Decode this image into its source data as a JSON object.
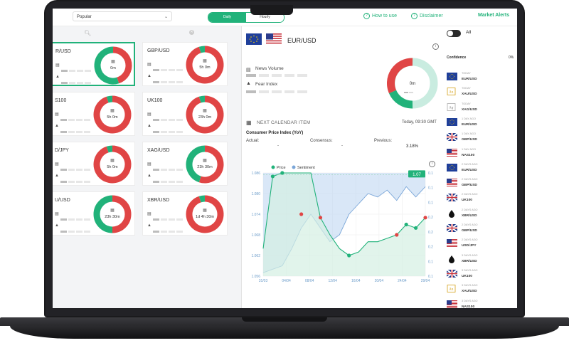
{
  "topbar": {
    "dropdown_value": "Popular",
    "tabs": [
      {
        "label": "Daily",
        "active": true
      },
      {
        "label": "Hourly",
        "active": false
      }
    ],
    "how_to_use": "How to use",
    "disclaimer": "Disclaimer",
    "market_alerts": "Market Alerts"
  },
  "cards": [
    {
      "symbol": "R/USD",
      "donut_label": "0m",
      "selected": true,
      "green_fraction": 0.55,
      "row": 0,
      "col": 0
    },
    {
      "symbol": "GBP/USD",
      "donut_label": "5h 0m",
      "selected": false,
      "green_fraction": 0.05,
      "row": 0,
      "col": 1
    },
    {
      "symbol": "S100",
      "donut_label": "5h 0m",
      "selected": false,
      "green_fraction": 0.05,
      "row": 1,
      "col": 0
    },
    {
      "symbol": "UK100",
      "donut_label": "23h 0m",
      "selected": false,
      "green_fraction": 0.05,
      "row": 1,
      "col": 1
    },
    {
      "symbol": "D/JPY",
      "donut_label": "5h 0m",
      "selected": false,
      "green_fraction": 0.05,
      "row": 2,
      "col": 0
    },
    {
      "symbol": "XAG/USD",
      "donut_label": "23h 30m",
      "selected": false,
      "green_fraction": 0.45,
      "row": 2,
      "col": 1
    },
    {
      "symbol": "U/USD",
      "donut_label": "23h 30m",
      "selected": false,
      "green_fraction": 0.5,
      "row": 3,
      "col": 0
    },
    {
      "symbol": "XBR/USD",
      "donut_label": "1d 4h 30m",
      "selected": false,
      "green_fraction": 0.05,
      "row": 3,
      "col": 1
    }
  ],
  "detail": {
    "pair": "EUR/USD",
    "news_volume_label": "News Volume",
    "fear_index_label": "Fear Index",
    "donut_label": "0m",
    "calendar_title": "NEXT CALENDAR ITEM",
    "calendar_time": "Today, 09:30 GMT",
    "event_name": "Consumer Price Index (YoY)",
    "actual_label": "Actual:",
    "actual_value": "-",
    "consensus_label": "Consensus:",
    "consensus_value": "-",
    "previous_label": "Previous:",
    "previous_value": "3.18%"
  },
  "chart_data": {
    "type": "line",
    "legend": [
      "Price",
      "Sentiment"
    ],
    "x": [
      "31/03",
      "04/04",
      "08/04",
      "12/04",
      "16/04",
      "20/04",
      "24/04",
      "29/04"
    ],
    "ylim_left": [
      1.056,
      1.086
    ],
    "yticks_left": [
      "1.086",
      "1.080",
      "1.074",
      "1.068",
      "1.062",
      "1.056"
    ],
    "yticks_right": [
      "0.1",
      "0.1",
      "0.1",
      "0.2",
      "0.2",
      "0.2",
      "0.1",
      "0.1"
    ],
    "current_price": "1.07",
    "series": [
      {
        "name": "Price",
        "color": "#21b27a",
        "values": [
          1.064,
          1.085,
          1.086,
          1.086,
          1.086,
          1.086,
          1.073,
          1.068,
          1.064,
          1.062,
          1.063,
          1.066,
          1.066,
          1.067,
          1.068,
          1.071,
          1.07,
          1.073
        ]
      },
      {
        "name": "Sentiment",
        "color": "#7aa6d8",
        "values": [
          1.057,
          1.058,
          1.059,
          1.064,
          1.07,
          1.074,
          1.07,
          1.066,
          1.068,
          1.074,
          1.077,
          1.08,
          1.079,
          1.081,
          1.078,
          1.082,
          1.079,
          1.082
        ]
      }
    ]
  },
  "right": {
    "all_label": "All",
    "confidence_label": "Confidence",
    "confidence_value": "0%",
    "alerts": [
      {
        "when": "TODAY",
        "symbol": "EUR/USD",
        "icon": "eu-us-flags-icon"
      },
      {
        "when": "TODAY",
        "symbol": "XAU/USD",
        "icon": "gold-icon"
      },
      {
        "when": "TODAY",
        "symbol": "XAG/USD",
        "icon": "silver-icon"
      },
      {
        "when": "1 DAY AGO",
        "symbol": "EUR/USD",
        "icon": "eu-us-flags-icon"
      },
      {
        "when": "1 DAY AGO",
        "symbol": "GBP/USD",
        "icon": "uk-us-flags-icon"
      },
      {
        "when": "1 DAY AGO",
        "symbol": "NAS100",
        "icon": "us-flag-icon"
      },
      {
        "when": "2 DAYS AGO",
        "symbol": "EUR/USD",
        "icon": "eu-us-flags-icon"
      },
      {
        "when": "2 DAYS AGO",
        "symbol": "GBP/USD",
        "icon": "us-flag-icon"
      },
      {
        "when": "2 DAYS AGO",
        "symbol": "UK100",
        "icon": "uk-flag-icon"
      },
      {
        "when": "2 DAYS AGO",
        "symbol": "XBR/USD",
        "icon": "oil-drop-icon"
      },
      {
        "when": "2 DAYS AGO",
        "symbol": "GBP/USD",
        "icon": "uk-us-flags-icon"
      },
      {
        "when": "2 DAYS AGO",
        "symbol": "USD/JPY",
        "icon": "us-jp-flags-icon"
      },
      {
        "when": "3 DAYS AGO",
        "symbol": "XBR/USD",
        "icon": "oil-drop-icon"
      },
      {
        "when": "3 DAYS AGO",
        "symbol": "UK100",
        "icon": "uk-flag-icon"
      },
      {
        "when": "3 DAYS AGO",
        "symbol": "XAU/USD",
        "icon": "gold-icon"
      },
      {
        "when": "3 DAYS AGO",
        "symbol": "NAS100",
        "icon": "us-flag-icon"
      }
    ]
  },
  "colors": {
    "green": "#21b27a",
    "red": "#e04545",
    "blue": "#7aa6d8",
    "eu": "#1f3f9a",
    "us_red": "#c8323c"
  }
}
